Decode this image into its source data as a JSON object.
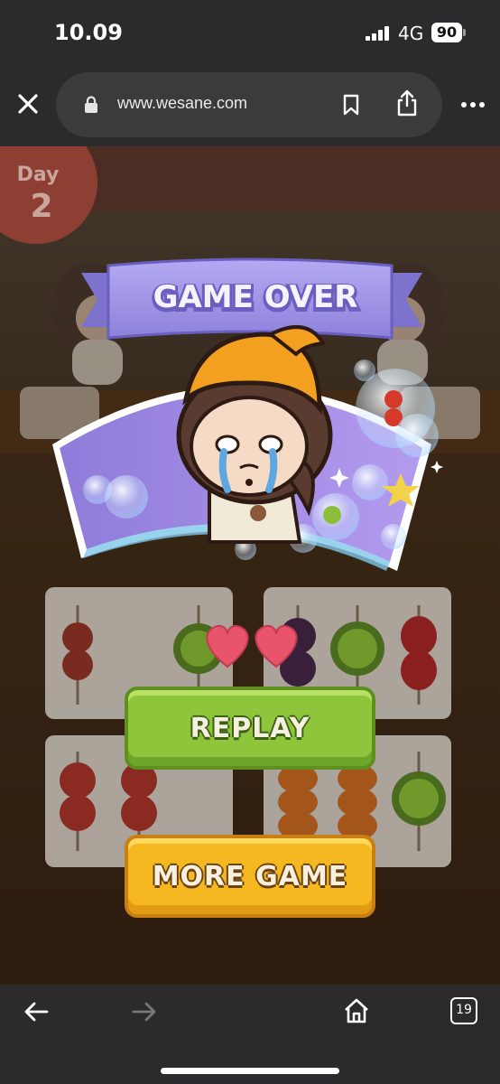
{
  "status_bar": {
    "time": "10.09",
    "network": "4G",
    "battery": "90"
  },
  "browser": {
    "url": "www.wesane.com",
    "tabs_count": "19"
  },
  "game": {
    "day_label": "Day",
    "day_number": "2",
    "banner_title": "GAME OVER",
    "lives_remaining": 2,
    "replay_label": "REPLAY",
    "more_game_label": "MORE GAME"
  },
  "colors": {
    "banner": "#9e93e6",
    "replay": "#8fc53b",
    "more_game": "#f5b820",
    "heart": "#e8546a"
  },
  "icons": [
    "close-icon",
    "lock-icon",
    "bookmark-icon",
    "share-icon",
    "more-icon",
    "back-icon",
    "forward-icon",
    "home-icon",
    "tabs-icon",
    "heart-icon"
  ]
}
